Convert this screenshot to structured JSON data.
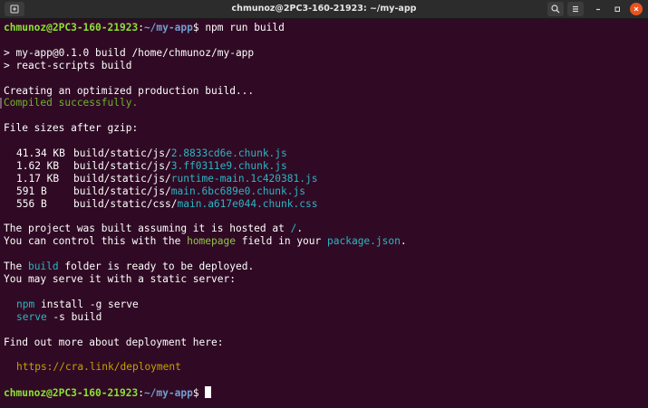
{
  "window": {
    "title": "chmunoz@2PC3-160-21923: ~/my-app"
  },
  "titlebar_icons": {
    "new_tab": "new-tab-icon",
    "search": "search-icon",
    "menu": "hamburger-menu-icon",
    "minimize": "minimize-icon",
    "maximize": "maximize-icon",
    "close": "close-icon"
  },
  "prompt": {
    "user_host": "chmunoz@2PC3-160-21923",
    "sep": ":",
    "path": "~/my-app",
    "symbol": "$",
    "command": " npm run build"
  },
  "output": {
    "l1": "> my-app@0.1.0 build /home/chmunoz/my-app",
    "l2": "> react-scripts build",
    "l3": "Creating an optimized production build...",
    "l4": "Compiled successfully.",
    "l5": "File sizes after gzip:",
    "files": [
      {
        "size": "41.34 KB",
        "dir": "build/static/js/",
        "name": "2.8833cd6e.chunk.js"
      },
      {
        "size": "1.62 KB",
        "dir": "build/static/js/",
        "name": "3.ff0311e9.chunk.js"
      },
      {
        "size": "1.17 KB",
        "dir": "build/static/js/",
        "name": "runtime-main.1c420381.js"
      },
      {
        "size": "591 B",
        "dir": "build/static/js/",
        "name": "main.6bc689e0.chunk.js"
      },
      {
        "size": "556 B",
        "dir": "build/static/css/",
        "name": "main.a617e044.chunk.css"
      }
    ],
    "hosted_a": "The project was built assuming it is hosted at ",
    "hosted_b": "/",
    "hosted_c": ".",
    "control_a": "You can control this with the ",
    "control_b": "homepage",
    "control_c": " field in your ",
    "control_d": "package.json",
    "control_e": ".",
    "ready_a": "The ",
    "ready_b": "build",
    "ready_c": " folder is ready to be deployed.",
    "serve_line": "You may serve it with a static server:",
    "cmd1_a": "npm",
    "cmd1_b": " install -g serve",
    "cmd2_a": "serve",
    "cmd2_b": " -s build",
    "more": "Find out more about deployment here:",
    "url": "https://cra.link/deployment"
  },
  "colors": {
    "background": "#300a24",
    "prompt_user": "#8ae234",
    "prompt_path": "#729fcf",
    "success": "#6cb52a",
    "cyan": "#2cb5c4",
    "yellow": "#c4a000"
  }
}
